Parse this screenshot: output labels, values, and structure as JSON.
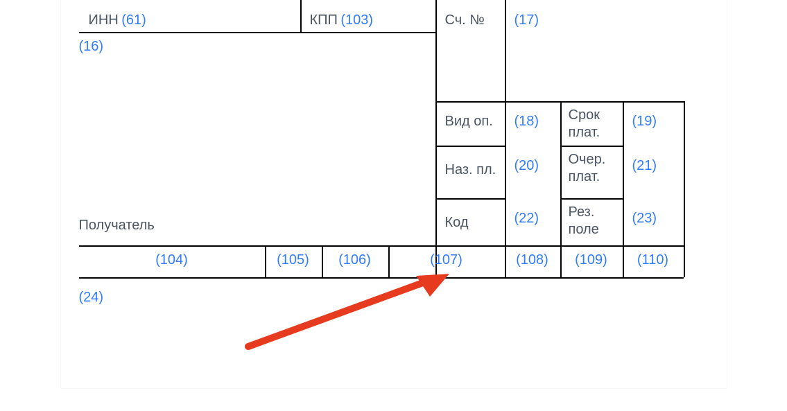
{
  "row1": {
    "inn_label": "ИНН",
    "inn_code": "(61)",
    "kpp_label": "КПП",
    "kpp_code": "(103)",
    "sch_label": "Сч. №",
    "sch_code": "(17)"
  },
  "row2": {
    "code16": "(16)"
  },
  "recipient_label": "Получатель",
  "grid": {
    "vid_op": {
      "label": "Вид оп.",
      "code": "(18)"
    },
    "srok": {
      "label": "Срок плат.",
      "code": "(19)"
    },
    "naz_pl": {
      "label": "Наз. пл.",
      "code": "(20)"
    },
    "ocher": {
      "label": "Очер. плат.",
      "code": "(21)"
    },
    "kod": {
      "label": "Код",
      "code": "(22)"
    },
    "rez": {
      "label": "Рез. поле",
      "code": "(23)"
    }
  },
  "bottom_codes": [
    "(104)",
    "(105)",
    "(106)",
    "(107)",
    "(108)",
    "(109)",
    "(110)"
  ],
  "code24": "(24)",
  "colors": {
    "link": "#2f7cff",
    "arrow": "#e63b1f"
  }
}
